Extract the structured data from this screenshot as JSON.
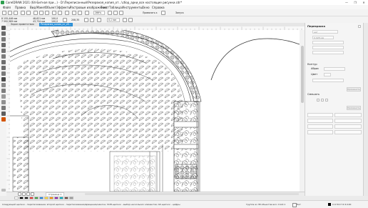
{
  "app": {
    "title": "CorelDRAW 2021 (64-Битная при...) - D:\\Переписанный\\Резервная_копия_от...\\сбор_арки_все настоящие рисунки.cdr*"
  },
  "window_controls": [
    "—",
    "❐",
    "✕"
  ],
  "menu": [
    "Файл",
    "Правка",
    "Вид",
    "Макет",
    "Объект",
    "Эффекты",
    "Растровые изображения",
    "Текст",
    "Таблица",
    "Инструменты",
    "Окно",
    "Справка"
  ],
  "toolbar1": {
    "zoom": "286%",
    "snap_label": "Привязать к",
    "launch_label": "Запуск"
  },
  "toolbar2": {
    "x": "8 155,446 мм",
    "y": "7 592,589 мм",
    "w": "48,621 мм",
    "h": "43,734 мм",
    "scale_w": "100,0",
    "scale_h": "100,0",
    "angle": "208,35",
    "outline": "0,1 мм"
  },
  "tabs": [
    "Экран приветствия",
    "Резервная_копия_от_сб..."
  ],
  "docker": {
    "title": "Перекраска",
    "section_outline": "Контур",
    "outline_label": "Абрис",
    "color_label": "Цвет",
    "section_combine": "Смешать",
    "field_placeholder_1": "нет",
    "field_value_2": "0,028 мм",
    "apply_label": "Применить"
  },
  "pagebar": {
    "page_label": "Страница 1"
  },
  "palette": {
    "colors": [
      "#ffffff",
      "#000000",
      "#1a1a1a",
      "#e53935",
      "#43a047",
      "#1e88e5",
      "#fdd835",
      "#fb8c00",
      "#8e24aa",
      "#00acc1",
      "#6d4c41",
      "#9e9e9e"
    ]
  },
  "status": {
    "hint": "Следующий щелчок - перетаскивание; второй щелчок - перетаскивание/вращение/наклон; Shift-щелчок - выбор нескольких элементов; Alt-щелчок - цифры",
    "objects": "Группа из 38 объектов вкл. Слой 1",
    "fill_label": "Нет",
    "outline_info": "C:0 M:0 Y:0 K:100"
  },
  "canvas": {
    "drawing": "ornament-arch"
  }
}
